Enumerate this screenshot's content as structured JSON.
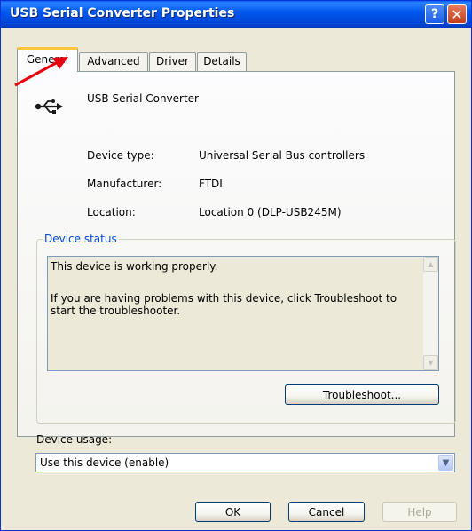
{
  "window": {
    "title": "USB Serial Converter Properties"
  },
  "titlebar_buttons": {
    "help": "?",
    "close": "✕"
  },
  "tabs": [
    {
      "label": "General",
      "active": true
    },
    {
      "label": "Advanced",
      "active": false
    },
    {
      "label": "Driver",
      "active": false
    },
    {
      "label": "Details",
      "active": false
    }
  ],
  "device": {
    "name": "USB Serial Converter",
    "icon": "usb-icon",
    "properties": [
      {
        "label": "Device type:",
        "value": "Universal Serial Bus controllers"
      },
      {
        "label": "Manufacturer:",
        "value": "FTDI"
      },
      {
        "label": "Location:",
        "value": "Location 0 (DLP-USB245M)"
      }
    ]
  },
  "device_status": {
    "legend": "Device status",
    "line1": "This device is working properly.",
    "line2": "If you are having problems with this device, click Troubleshoot to start the troubleshooter.",
    "troubleshoot_label": "Troubleshoot..."
  },
  "device_usage": {
    "label": "Device usage:",
    "selected": "Use this device (enable)"
  },
  "footer": {
    "ok": "OK",
    "cancel": "Cancel",
    "help": "Help"
  },
  "colors": {
    "title_bar": "#0058ee",
    "legend": "#0046d5",
    "annotation_arrow": "#e8000d"
  }
}
